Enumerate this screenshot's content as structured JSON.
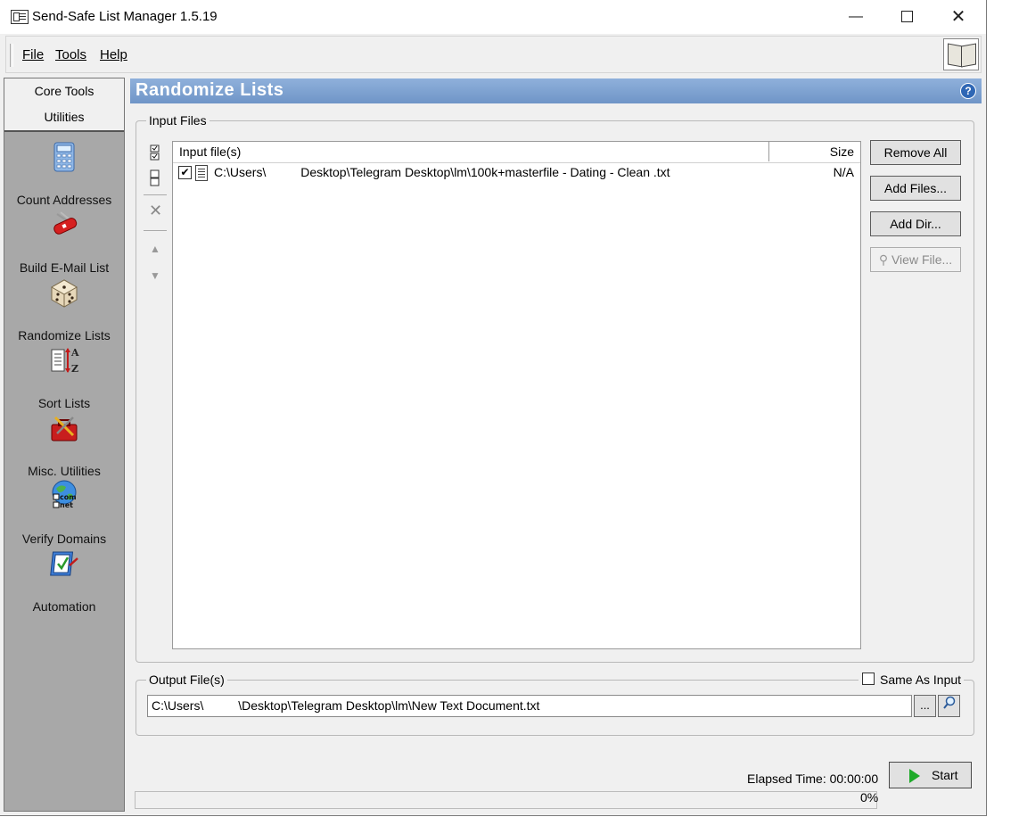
{
  "window": {
    "title": "Send-Safe List Manager 1.5.19"
  },
  "menu": {
    "items": [
      "File",
      "Tools",
      "Help"
    ]
  },
  "nav": {
    "tabs": [
      "Core Tools",
      "Utilities"
    ],
    "tools": [
      {
        "label": "Count Addresses",
        "icon": "calculator-icon"
      },
      {
        "label": "Build E-Mail List",
        "icon": "swiss-knife-icon"
      },
      {
        "label": "Randomize Lists",
        "icon": "dice-icon"
      },
      {
        "label": "Sort Lists",
        "icon": "sort-az-icon"
      },
      {
        "label": "Misc. Utilities",
        "icon": "toolbox-icon"
      },
      {
        "label": "Verify Domains",
        "icon": "globe-com-net-icon"
      },
      {
        "label": "Automation",
        "icon": "automation-icon"
      }
    ]
  },
  "panel": {
    "title": "Randomize Lists",
    "input_group": {
      "legend": "Input Files",
      "columns": [
        "Input file(s)",
        "Size"
      ],
      "rows": [
        {
          "checked": true,
          "path": "C:\\Users\\          Desktop\\Telegram Desktop\\lm\\100k+masterfile - Dating - Clean .txt",
          "size": "N/A"
        }
      ],
      "buttons": {
        "remove_all": "Remove All",
        "add_files": "Add Files...",
        "add_dir": "Add Dir...",
        "view_file": "View File..."
      }
    },
    "output_group": {
      "legend": "Output File(s)",
      "same_as_input": "Same As Input",
      "value": "C:\\Users\\          \\Desktop\\Telegram Desktop\\lm\\New Text Document.txt",
      "browse": "..."
    },
    "elapsed_label": "Elapsed Time:",
    "elapsed_value": "00:00:00",
    "start": "Start",
    "progress": "0%",
    "progress_fraction": 0
  }
}
